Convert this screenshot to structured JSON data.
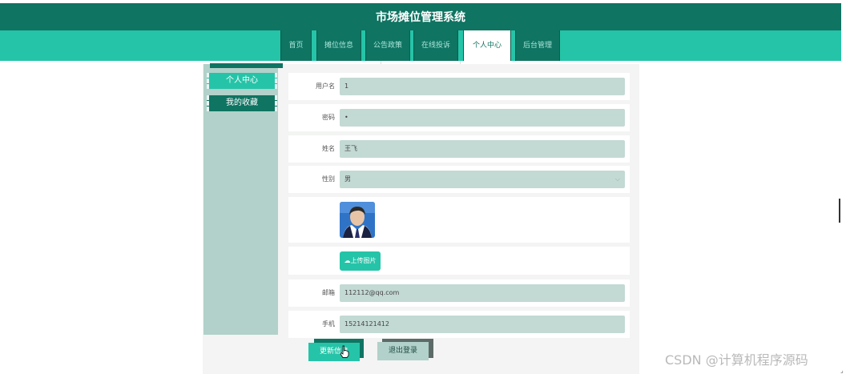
{
  "app": {
    "title": "市场摊位管理系统"
  },
  "nav": {
    "items": [
      {
        "label": "首页"
      },
      {
        "label": "摊位信息"
      },
      {
        "label": "公告政策"
      },
      {
        "label": "在线投诉"
      },
      {
        "label": "个人中心",
        "active": true
      },
      {
        "label": "后台管理"
      }
    ]
  },
  "sidebar": {
    "items": [
      {
        "label": "个人中心",
        "active": true
      },
      {
        "label": "我的收藏"
      }
    ]
  },
  "form": {
    "username": {
      "label": "用户名",
      "value": "1"
    },
    "password": {
      "label": "密码",
      "value": "•"
    },
    "name": {
      "label": "姓名",
      "value": "王飞"
    },
    "gender": {
      "label": "性别",
      "value": "男"
    },
    "upload": {
      "label": "上传图片"
    },
    "email": {
      "label": "邮箱",
      "value": "112112@qq.com"
    },
    "phone": {
      "label": "手机",
      "value": "15214121412"
    }
  },
  "actions": {
    "update": "更新信息",
    "logout": "退出登录"
  },
  "watermark": "CSDN @计算机程序源码",
  "colors": {
    "primary": "#0f7462",
    "accent": "#25c4a8",
    "field": "#c3d9d4",
    "sidebar": "#b1d1ca"
  },
  "icons": {
    "upload": "cloud-upload-icon",
    "select": "chevron-down-icon",
    "cursor": "hand-pointer-icon"
  }
}
